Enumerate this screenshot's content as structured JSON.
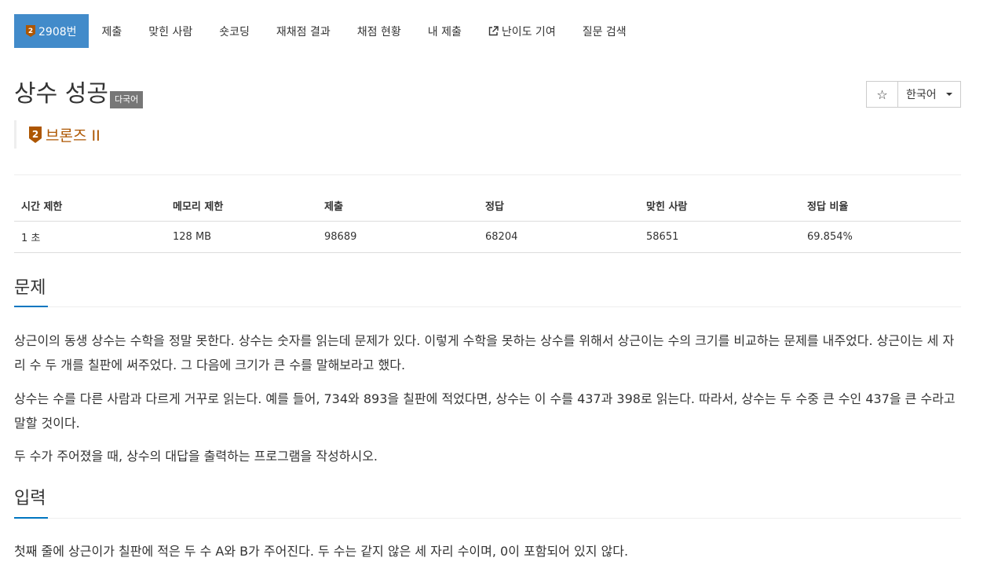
{
  "nav": {
    "problem_number": "2908번",
    "items": [
      "제출",
      "맞힌 사람",
      "숏코딩",
      "재채점 결과",
      "채점 현황",
      "내 제출",
      "난이도 기여",
      "질문 검색"
    ]
  },
  "title": {
    "text": "상수 성공",
    "label": "다국어"
  },
  "actions": {
    "star": "☆",
    "language": "한국어"
  },
  "tier": {
    "level": "2",
    "text": "브론즈 II",
    "color": "#ad5600"
  },
  "stats": {
    "headers": [
      "시간 제한",
      "메모리 제한",
      "제출",
      "정답",
      "맞힌 사람",
      "정답 비율"
    ],
    "values": [
      "1 초",
      "128 MB",
      "98689",
      "68204",
      "58651",
      "69.854%"
    ]
  },
  "sections": {
    "problem": {
      "title": "문제",
      "paragraphs": [
        "상근이의 동생 상수는 수학을 정말 못한다. 상수는 숫자를 읽는데 문제가 있다. 이렇게 수학을 못하는 상수를 위해서 상근이는 수의 크기를 비교하는 문제를 내주었다. 상근이는 세 자리 수 두 개를 칠판에 써주었다. 그 다음에 크기가 큰 수를 말해보라고 했다.",
        "상수는 수를 다른 사람과 다르게 거꾸로 읽는다. 예를 들어, 734와 893을 칠판에 적었다면, 상수는 이 수를 437과 398로 읽는다. 따라서, 상수는 두 수중 큰 수인 437을 큰 수라고 말할 것이다.",
        "두 수가 주어졌을 때, 상수의 대답을 출력하는 프로그램을 작성하시오."
      ]
    },
    "input": {
      "title": "입력",
      "paragraphs": [
        "첫째 줄에 상근이가 칠판에 적은 두 수 A와 B가 주어진다. 두 수는 같지 않은 세 자리 수이며, 0이 포함되어 있지 않다."
      ]
    }
  }
}
